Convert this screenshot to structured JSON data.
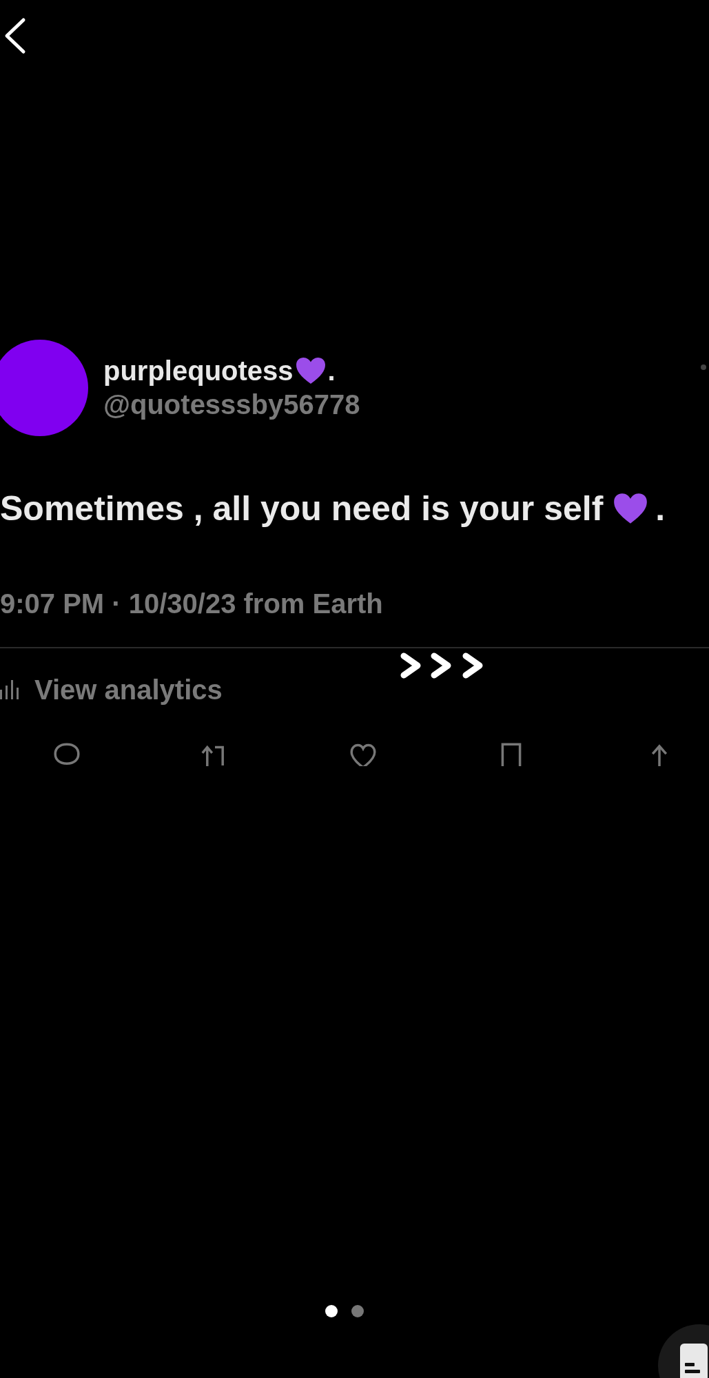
{
  "post": {
    "display_name": "purplequotess",
    "name_suffix": ".",
    "handle": "@quotesssby56778",
    "text": "Sometimes , all you need is your self",
    "text_suffix": ".",
    "meta": "9:07 PM · 10/30/23 from Earth",
    "analytics": "View analytics"
  },
  "pager": [
    {
      "selected": true
    },
    {
      "selected": false
    }
  ]
}
